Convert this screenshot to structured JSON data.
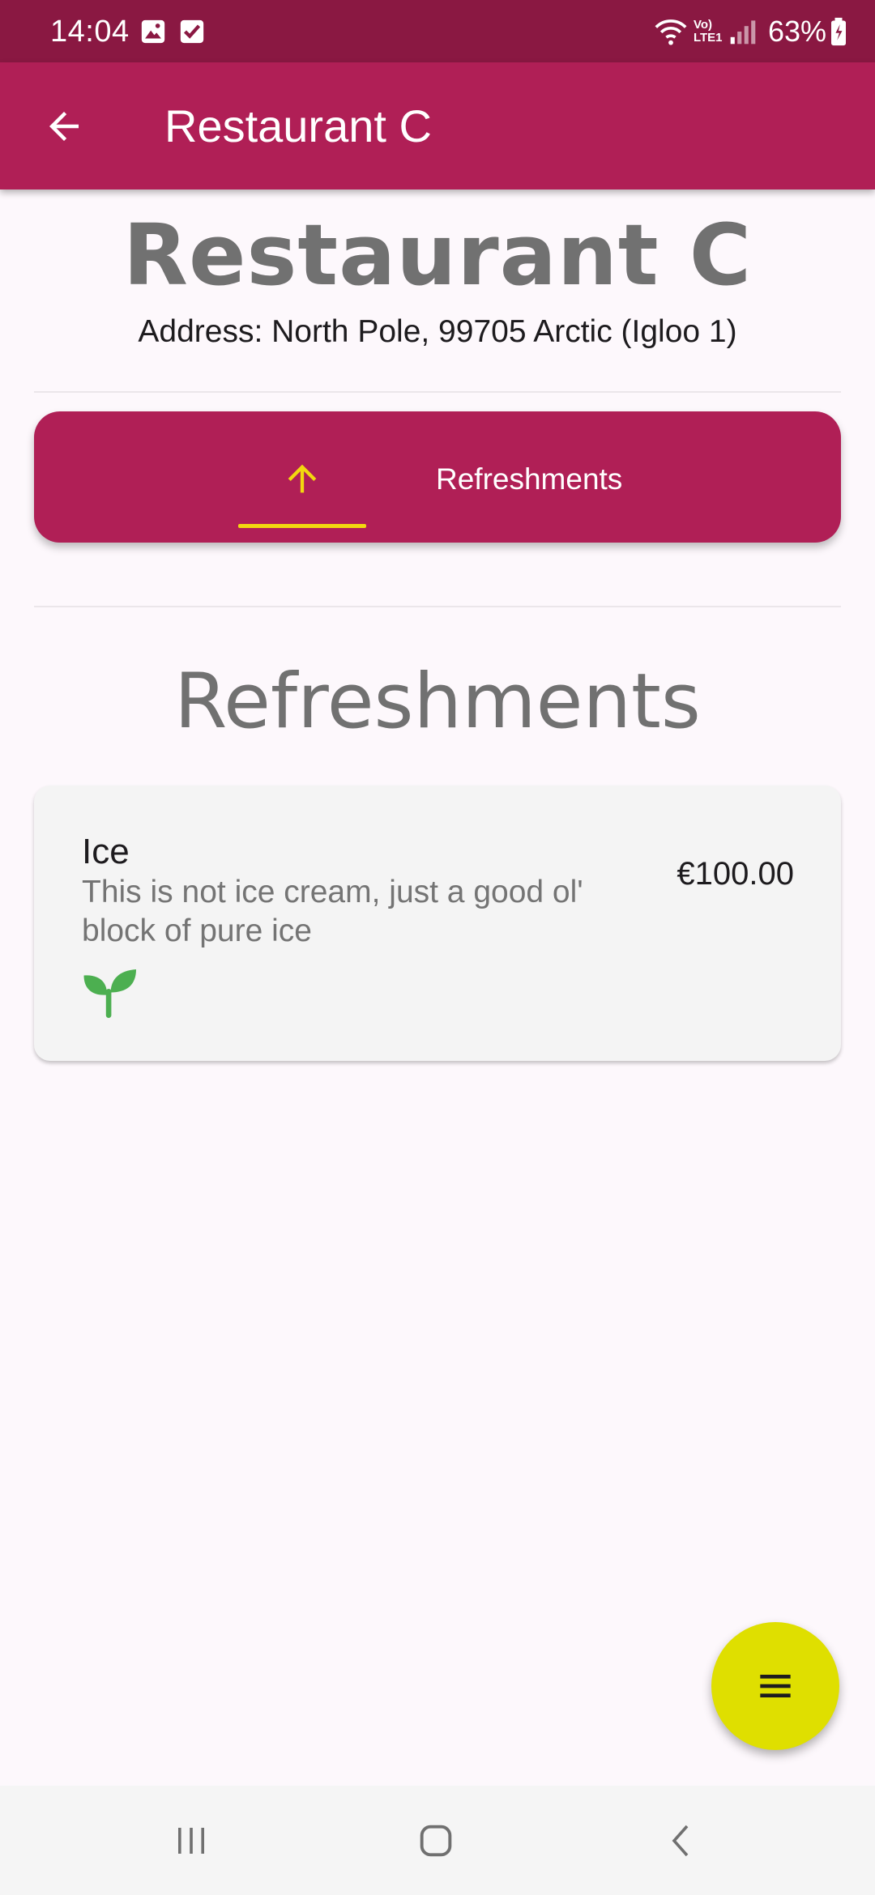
{
  "status_bar": {
    "time": "14:04",
    "network": "Vo) LTE1",
    "battery_percent": "63%"
  },
  "app_bar": {
    "title": "Restaurant C",
    "back_icon": "arrow-back-icon"
  },
  "header": {
    "name": "Restaurant C",
    "address": "Address: North Pole, 99705 Arctic (Igloo 1)"
  },
  "category_tabs": [
    {
      "icon": "arrow-up-icon",
      "label": "Refreshments",
      "selected": true
    }
  ],
  "section": {
    "title": "Refreshments",
    "items": [
      {
        "name": "Ice",
        "description": "This is not ice cream, just a good ol' block of pure ice",
        "price": "€100.00",
        "tag_icon": "sprout-icon"
      }
    ]
  },
  "fab": {
    "icon": "menu-icon"
  },
  "nav_bar": {
    "icons": [
      "recents-icon",
      "home-icon",
      "back-icon"
    ]
  },
  "colors": {
    "primary": "#b01f56",
    "status_bar": "#8a1842",
    "accent": "#f2d80f",
    "fab": "#dfdf00",
    "veg_green": "#4caf50",
    "muted_text": "#717171"
  }
}
